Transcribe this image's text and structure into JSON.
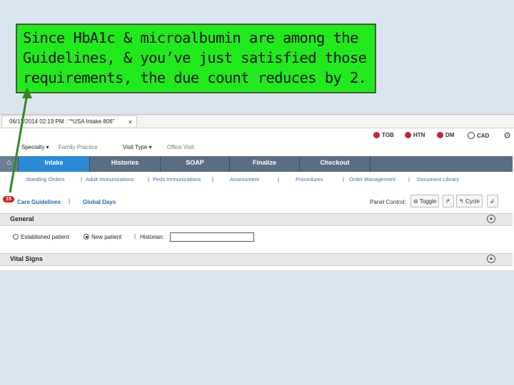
{
  "annotation": {
    "text": "Since HbA1c & microalbumin are among the\nGuidelines, & you’ve just satisfied those\nrequirements, the due count reduces by 2."
  },
  "window": {
    "doc_tab_title": "06/1?/2014 02:19 PM : \"*USA Intake 806\"",
    "close_glyph": "×"
  },
  "header": {
    "specialty_label": "Specialty ▾",
    "specialty_value": "Family Practice",
    "visit_type_label": "Visit Type ▾",
    "visit_type_value": "Office Visit",
    "alerts": [
      "TOB",
      "HTN",
      "DM",
      "CAD"
    ]
  },
  "nav": {
    "tabs": [
      "Intake",
      "Histories",
      "SOAP",
      "Finalize",
      "Checkout"
    ],
    "active": "Intake"
  },
  "subnav": {
    "items": [
      "Standing Orders",
      "Adult Immunizations",
      "Peds Immunizations",
      "Assessment",
      "Procedures",
      "Order Management",
      "Document Library"
    ]
  },
  "toolbar": {
    "badge_count": "15",
    "care_guidelines": "Care Guidelines",
    "global_days": "Global Days",
    "panel_control_label": "Panel Control:",
    "toggle_label": "Toggle",
    "cycle_label": "Cycle"
  },
  "panels": {
    "general_title": "General",
    "vital_signs_title": "Vital Signs",
    "established_patient": "Established patient",
    "new_patient": "New patient",
    "historian_label": "Historian:"
  },
  "colors": {
    "callout_bg": "#21ea1c",
    "arrow": "#2f8a1e",
    "active_tab": "#2a8ad6",
    "nav_bg": "#5a6e82",
    "alert_red": "#c8262a"
  }
}
